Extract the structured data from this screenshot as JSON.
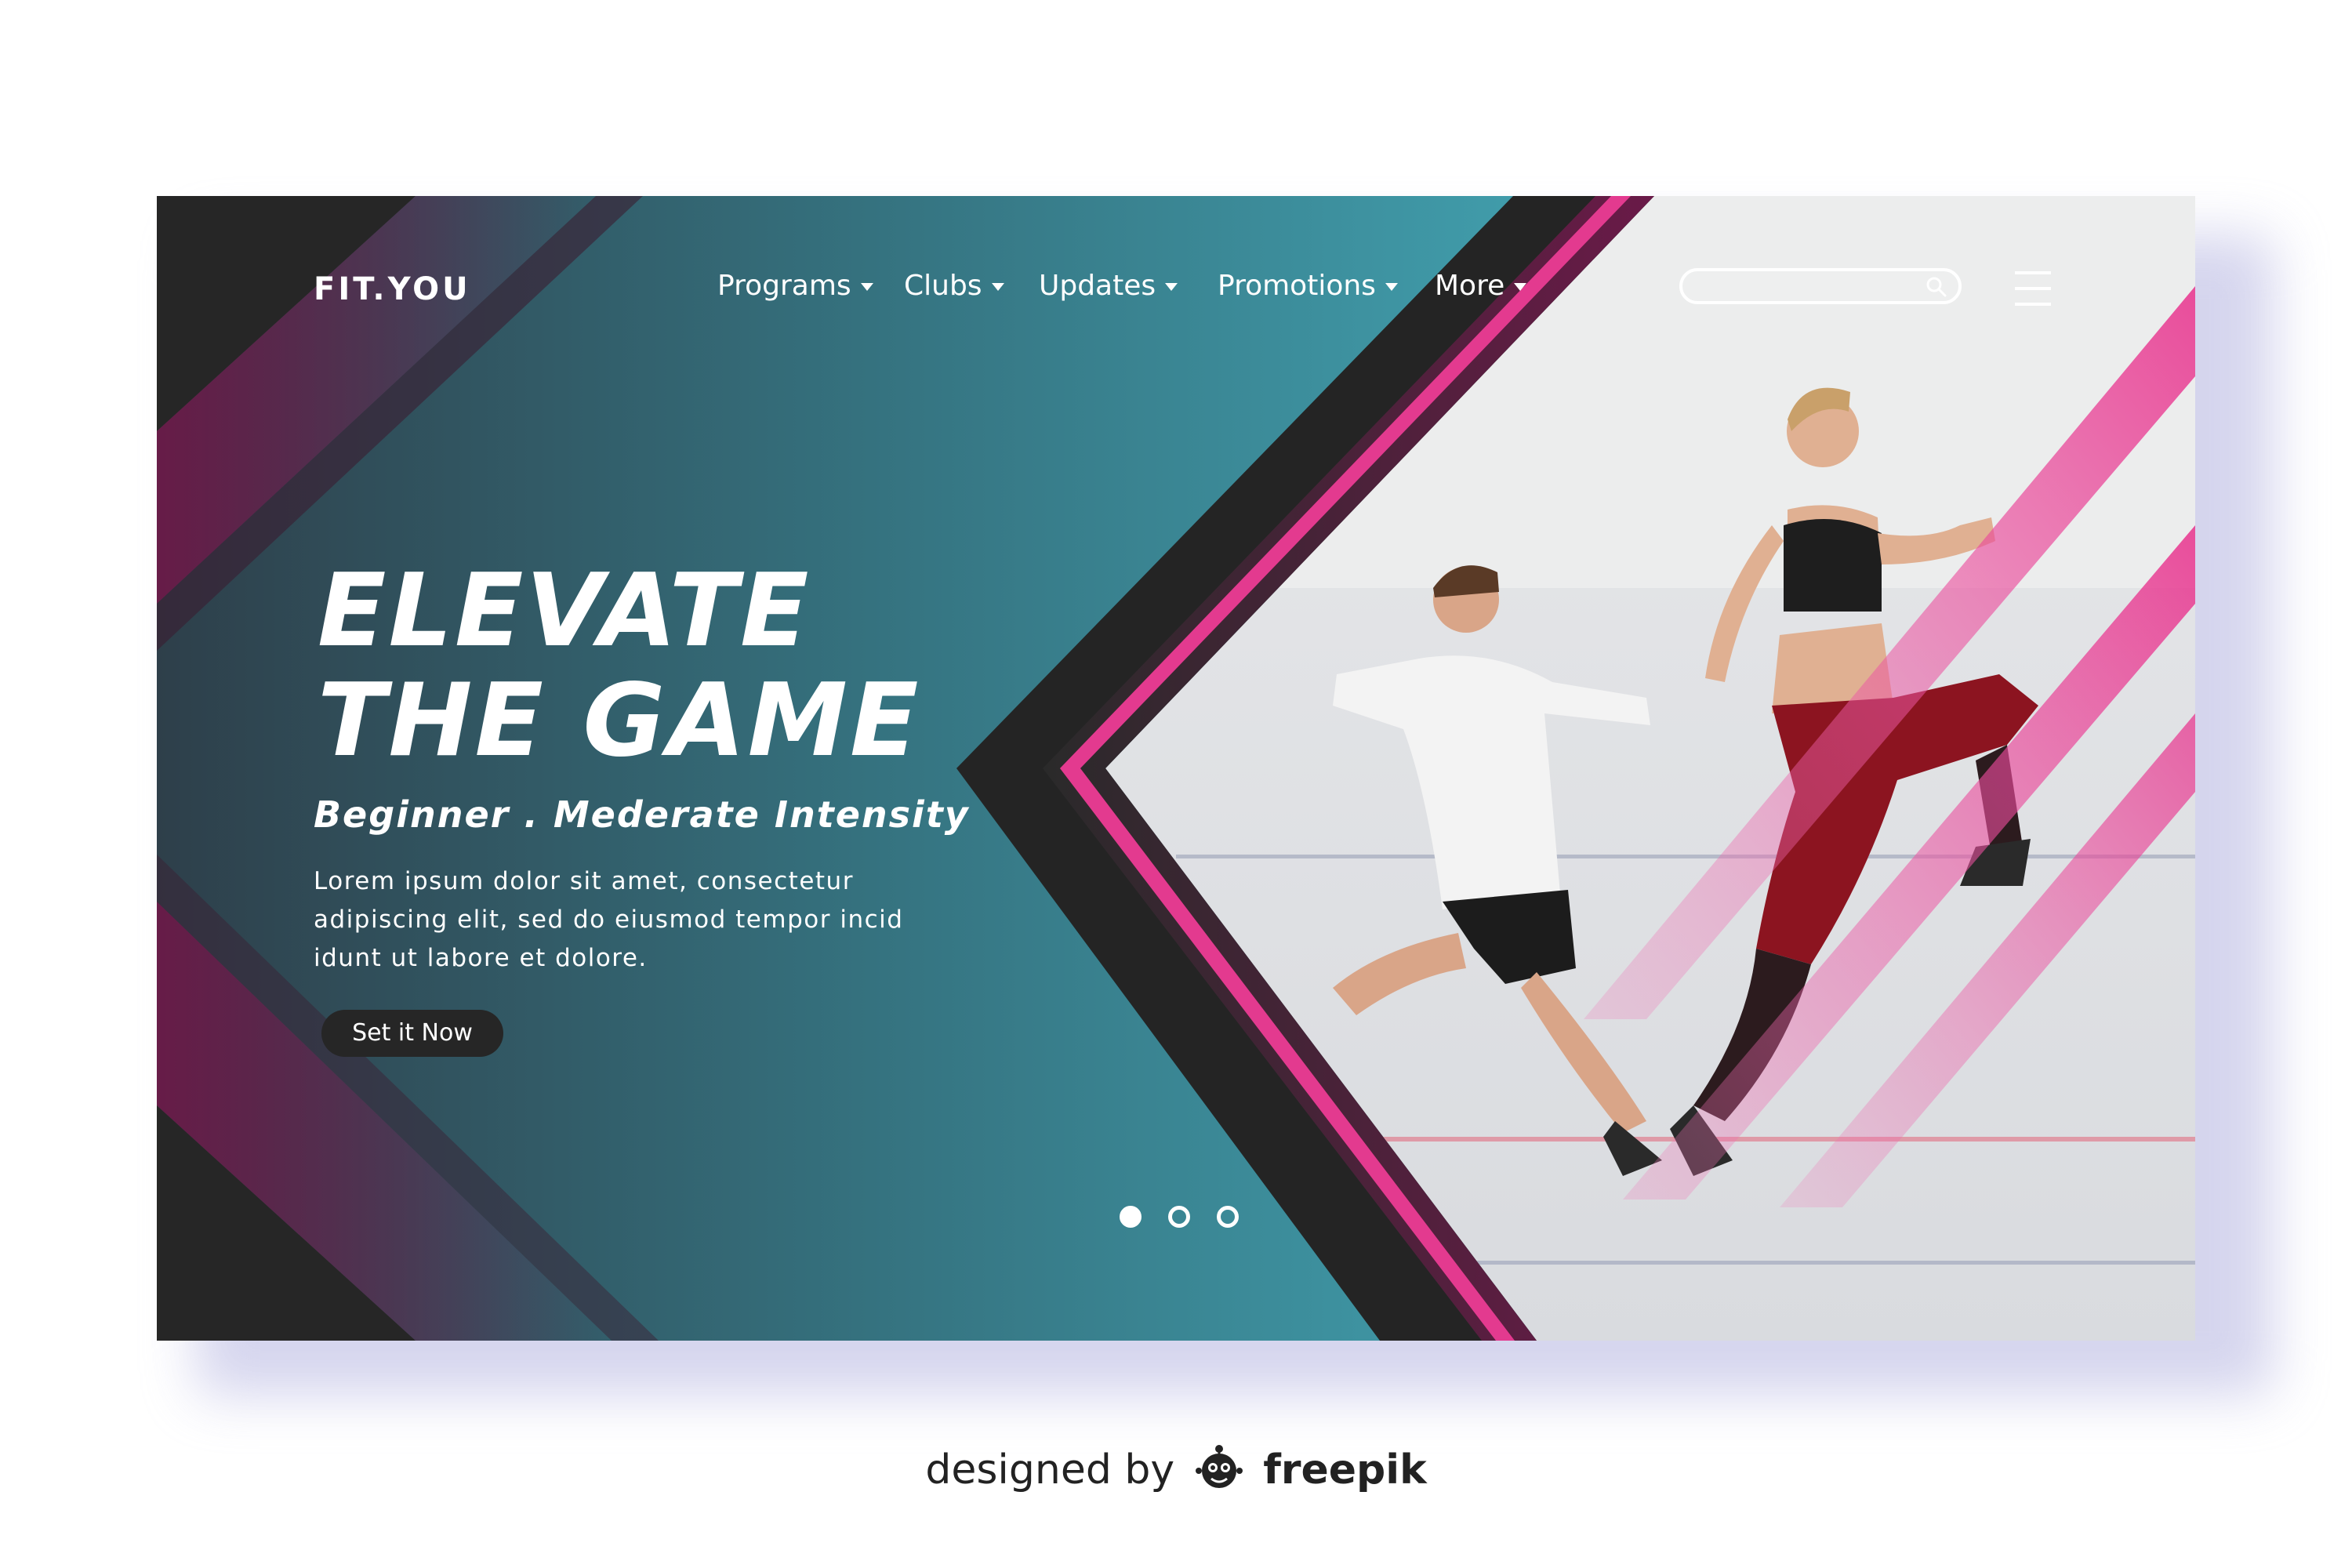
{
  "brand": {
    "logo": "FIT.YOU"
  },
  "nav": {
    "items": [
      {
        "label": "Programs"
      },
      {
        "label": "Clubs"
      },
      {
        "label": "Updates"
      },
      {
        "label": "Promotions"
      },
      {
        "label": "More"
      }
    ]
  },
  "search": {
    "placeholder": "",
    "value": ""
  },
  "hero": {
    "headline_line1": "ELEVATE",
    "headline_line2": "THE GAME",
    "subline": "Beginner . Mederate Intensity",
    "body": "Lorem ipsum dolor sit amet, consectetur adipiscing elit, sed do eiusmod tempor incid idunt ut labore et dolore.",
    "cta_label": "Set it Now",
    "image_description_icon": "runners-photo"
  },
  "slider": {
    "total": 3,
    "active_index": 1
  },
  "credit": {
    "prefix": "designed by",
    "brand": "freepik"
  },
  "colors": {
    "teal_light": "#4cc8d8",
    "teal_dark": "#2f6b78",
    "magenta": "#e33a8f",
    "plum": "#6a1a48",
    "dark": "#262626",
    "shadow": "#b3b3e0"
  }
}
